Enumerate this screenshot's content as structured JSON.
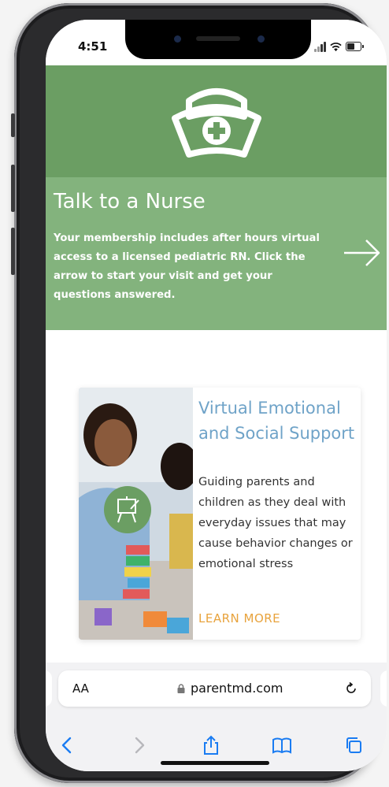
{
  "status_bar": {
    "time": "4:51"
  },
  "banner": {
    "title": "Talk to a Nurse",
    "text": "Your membership includes after hours virtual access to a licensed pediatric RN. Click the arrow to start your visit and get your questions answered."
  },
  "card": {
    "title": "Virtual Emotional and Social Support",
    "description": "Guiding parents and children as they deal with everyday issues that may cause behavior changes or emotional stress",
    "cta": "LEARN MORE"
  },
  "browser": {
    "text_size_label": "AA",
    "url": "parentmd.com"
  },
  "icons": [
    "nurse-cap-icon",
    "arrow-right-icon",
    "easel-icon",
    "lock-icon",
    "reload-icon",
    "back-icon",
    "forward-icon",
    "share-icon",
    "bookmarks-icon",
    "tabs-icon"
  ],
  "colors": {
    "hero_green": "#6b9e63",
    "banner_green": "#83b37d",
    "title_blue": "#6fa3c8",
    "cta_orange": "#e8a33d",
    "ios_blue": "#1a7cf2"
  }
}
